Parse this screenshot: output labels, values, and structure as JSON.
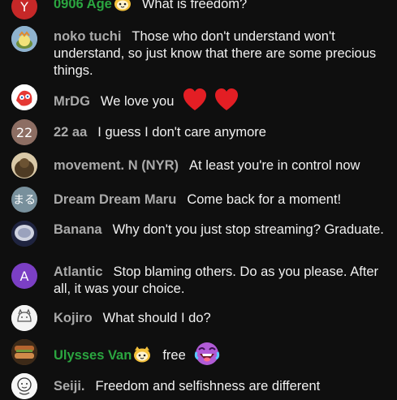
{
  "colors": {
    "background": "#0f0f0f",
    "author": "#aaaaaa",
    "member_author": "#2ba640",
    "message": "#f1f1f1"
  },
  "messages": [
    {
      "author": "0906 Age",
      "member": true,
      "avatar_text": "Y",
      "avatar_color": "#c62828",
      "badge": "member-badge-icon",
      "text": "What is freedom?"
    },
    {
      "author": "noko tuchi",
      "member": false,
      "avatar_text": "",
      "avatar_color": "#7aa0c0",
      "text": "Those who don't understand won't understand, so just know that there are some precious things."
    },
    {
      "author": "MrDG",
      "member": false,
      "avatar_text": "",
      "avatar_color": "#ffffff",
      "text": "We love you",
      "emojis": [
        "red-heart-icon",
        "red-heart-icon"
      ]
    },
    {
      "author": "22 aa",
      "member": false,
      "avatar_text": "22",
      "avatar_color": "#8d6e63",
      "text": "I guess I don't care anymore"
    },
    {
      "author": "movement. N (NYR)",
      "member": false,
      "avatar_text": "",
      "avatar_color": "#5b4630",
      "text": "At least you're in control now"
    },
    {
      "author": "Dream Dream Maru",
      "member": false,
      "avatar_text": "まる",
      "avatar_color": "#78909c",
      "text": "Come back for a moment!"
    },
    {
      "author": "Banana",
      "member": false,
      "avatar_text": "",
      "avatar_color": "#2a2d4a",
      "text": "Why don't you just stop streaming? Graduate."
    },
    {
      "author": "Atlantic",
      "member": false,
      "avatar_text": "A",
      "avatar_color": "#7b3fc4",
      "text": "Stop blaming others. Do as you please. After all, it was your choice."
    },
    {
      "author": "Kojiro",
      "member": false,
      "avatar_text": "",
      "avatar_color": "#f2f2f2",
      "text": "What should I do?"
    },
    {
      "author": "Ulysses Van",
      "member": true,
      "avatar_text": "",
      "avatar_color": "#6b4a2e",
      "badge": "member-badge-icon",
      "text": "free",
      "emojis": [
        "laughing-face-icon"
      ]
    },
    {
      "author": "Seiji.",
      "member": false,
      "avatar_text": "",
      "avatar_color": "#f5f5f5",
      "text": "Freedom and selfishness are different"
    }
  ]
}
